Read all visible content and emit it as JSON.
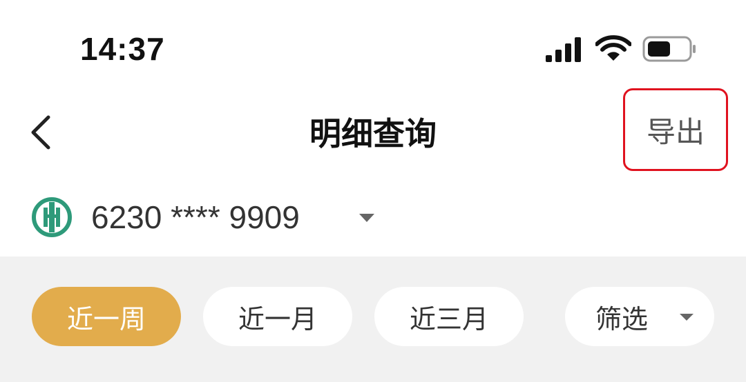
{
  "status_bar": {
    "time": "14:37",
    "icons": [
      "cellular-signal-icon",
      "wifi-icon",
      "battery-icon"
    ]
  },
  "nav": {
    "back_icon": "chevron-left-icon",
    "title": "明细查询",
    "export_label": "导出"
  },
  "account": {
    "bank_logo_icon": "bank-logo-icon",
    "number": "6230 **** 9909",
    "dropdown_icon": "caret-down-icon"
  },
  "filters": {
    "tabs": [
      {
        "label": "近一周",
        "active": true
      },
      {
        "label": "近一月",
        "active": false
      },
      {
        "label": "近三月",
        "active": false
      }
    ],
    "filter_label": "筛选",
    "filter_icon": "caret-down-icon"
  },
  "colors": {
    "accent": "#e2ac4c",
    "highlight_border": "#e0121f",
    "bank_logo": "#2e9a7a",
    "filter_background": "#f1f1f1"
  }
}
